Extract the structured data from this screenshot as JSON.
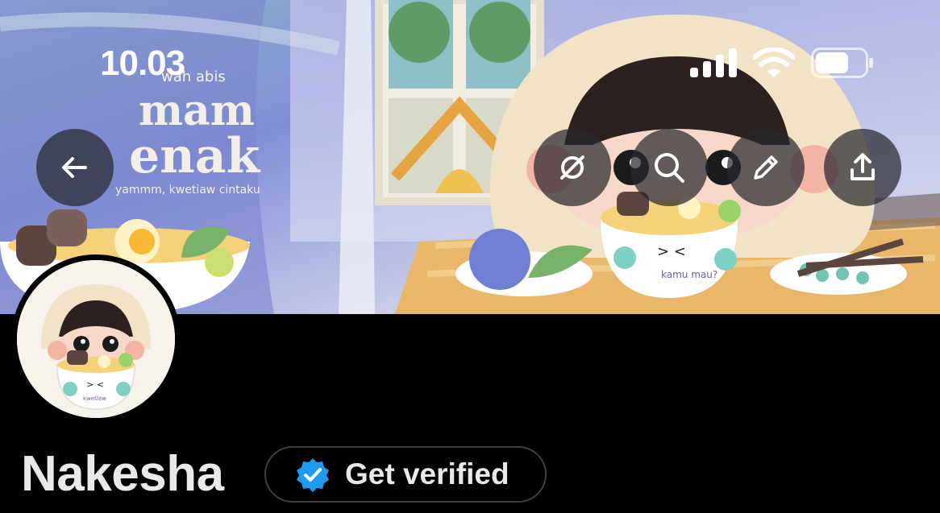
{
  "status_bar": {
    "time": "10.03"
  },
  "banner": {
    "title_small": "wah abis",
    "title_line1": "mam",
    "title_line2": "enak",
    "subtitle": "yammm, kwetiaw cintaku",
    "bowl_text": "kamu mau?",
    "avatar_bowl_text": "kwetiaw"
  },
  "header_actions": {
    "back": "back-arrow-icon",
    "grok": "grok-icon",
    "search": "search-icon",
    "edit": "pencil-icon",
    "share": "share-icon"
  },
  "profile": {
    "name": "Nakesha",
    "verify_label": "Get verified"
  },
  "colors": {
    "background": "#000000",
    "verified_blue": "#1d9bf0",
    "button_overlay": "#28282e"
  }
}
